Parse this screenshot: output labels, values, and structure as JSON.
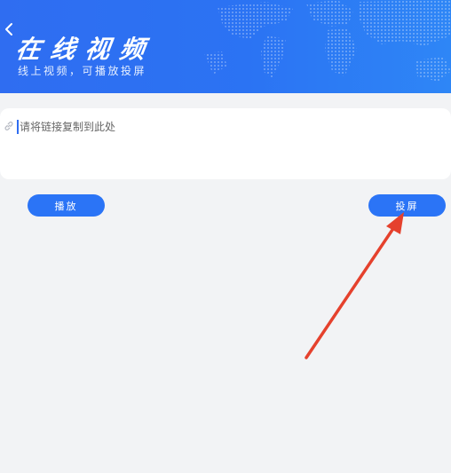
{
  "header": {
    "title": "在线视频",
    "subtitle": "线上视频，可播放投屏",
    "back_icon": "chevron-left-icon"
  },
  "link_input": {
    "placeholder": "请将链接复制到此处",
    "value": "",
    "icon": "link-icon"
  },
  "actions": {
    "play_label": "播放",
    "cast_label": "投屏"
  },
  "colors": {
    "header_blue": "#2f6df1",
    "button_blue": "#2b74f6",
    "background": "#f2f3f5",
    "annotation_arrow": "#e5412d"
  }
}
